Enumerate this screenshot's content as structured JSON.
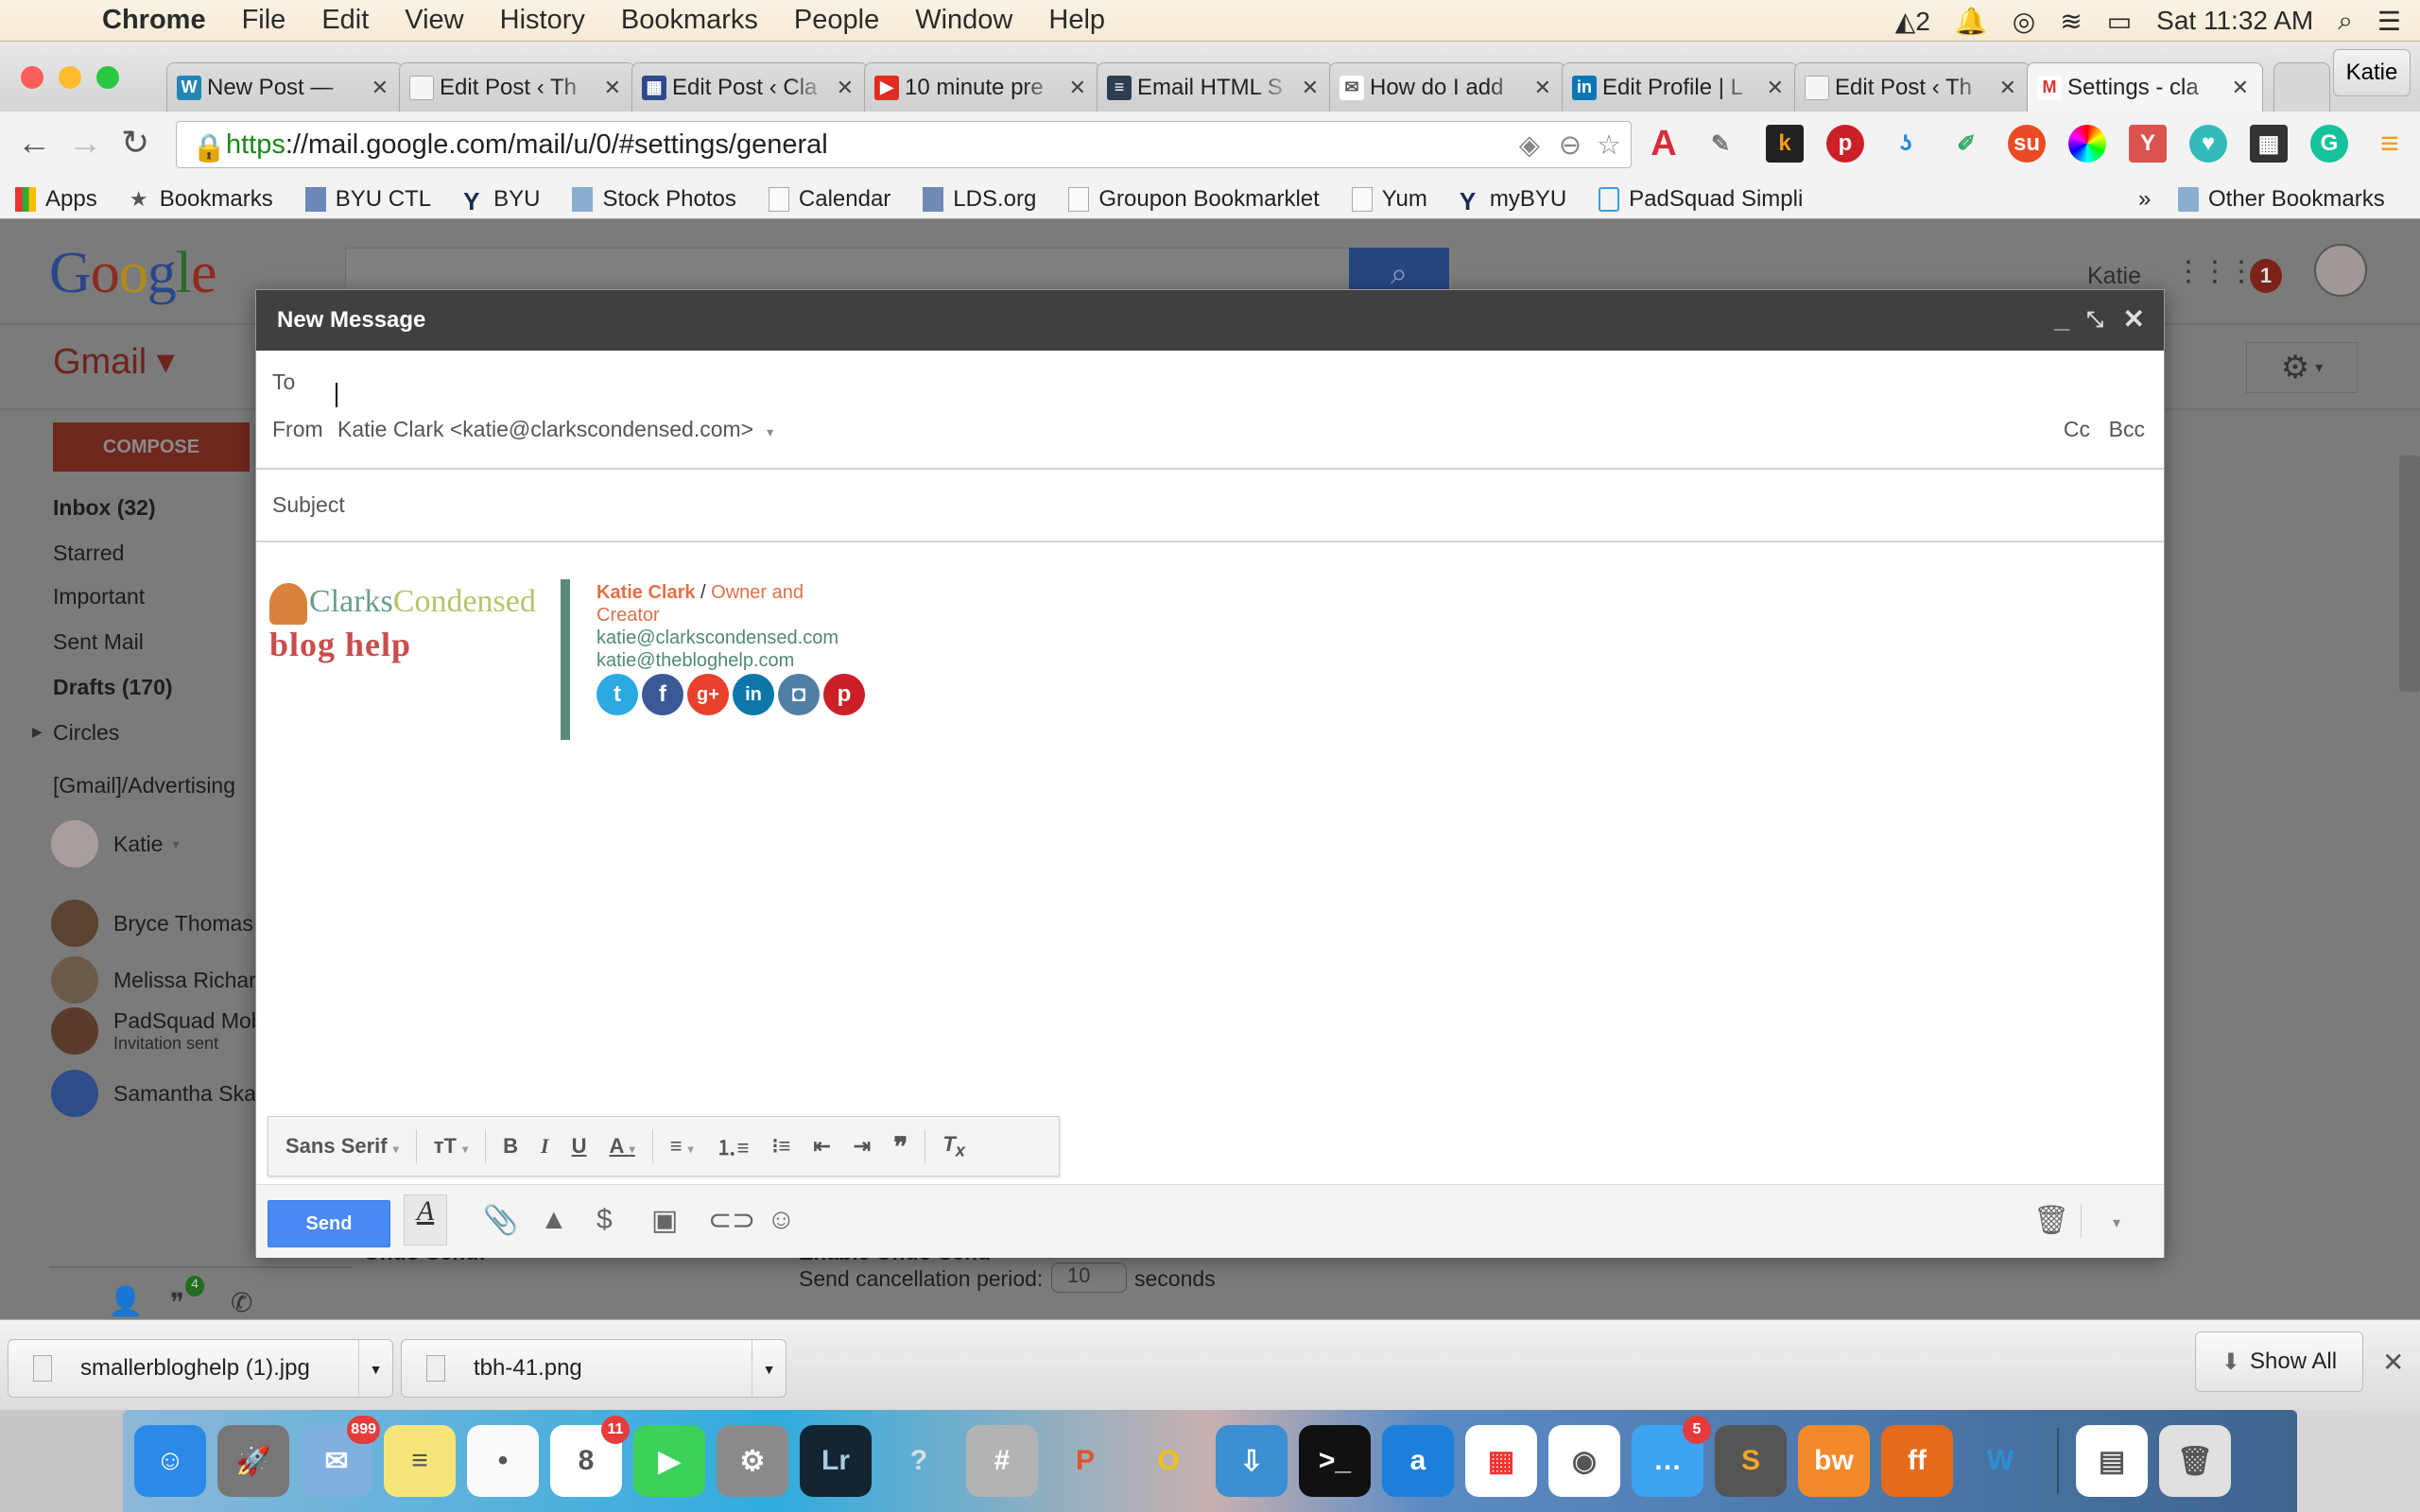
{
  "menubar": {
    "app": "Chrome",
    "items": [
      "File",
      "Edit",
      "View",
      "History",
      "Bookmarks",
      "People",
      "Window",
      "Help"
    ],
    "status": {
      "adobe_count": "2",
      "clock": "Sat 11:32 AM"
    }
  },
  "tabs": [
    {
      "title": "New Post — ",
      "icon": "wordpress-icon",
      "color": "#2385b5",
      "glyph": "W"
    },
    {
      "title": "Edit Post ‹ Th",
      "icon": "page-icon",
      "color": "#f5f5f5",
      "glyph": ""
    },
    {
      "title": "Edit Post ‹ Cla",
      "icon": "grid-site-icon",
      "color": "#2e4a8a",
      "glyph": "▦"
    },
    {
      "title": "10 minute pre",
      "icon": "youtube-icon",
      "color": "#e02b20",
      "glyph": "▶"
    },
    {
      "title": "Email HTML S",
      "icon": "document-icon",
      "color": "#2d3d52",
      "glyph": "≡"
    },
    {
      "title": "How do I add",
      "icon": "htmlsig-icon",
      "color": "#ffffff",
      "glyph": "✉"
    },
    {
      "title": "Edit Profile | L",
      "icon": "linkedin-icon",
      "color": "#0a77b5",
      "glyph": "in"
    },
    {
      "title": "Edit Post ‹ Th",
      "icon": "page-icon",
      "color": "#f5f5f5",
      "glyph": ""
    },
    {
      "title": "Settings - cla",
      "icon": "gmail-icon",
      "color": "#ffffff",
      "glyph": "M",
      "active": true
    }
  ],
  "profile_button": "Katie",
  "address": {
    "scheme": "https",
    "rest": "://mail.google.com/mail/u/0/#settings/general"
  },
  "bookmarks": [
    {
      "label": "Apps",
      "icon": "apps-grid-icon"
    },
    {
      "label": "Bookmarks",
      "icon": "star-icon"
    },
    {
      "label": "BYU CTL",
      "icon": "byu-ctl-icon"
    },
    {
      "label": "BYU",
      "icon": "byu-y-icon"
    },
    {
      "label": "Stock Photos",
      "icon": "folder-icon"
    },
    {
      "label": "Calendar",
      "icon": "page-icon"
    },
    {
      "label": "LDS.org",
      "icon": "lds-icon"
    },
    {
      "label": "Groupon Bookmarklet",
      "icon": "page-icon"
    },
    {
      "label": "Yum",
      "icon": "page-icon"
    },
    {
      "label": "myBYU",
      "icon": "byu-y-icon"
    },
    {
      "label": "PadSquad Simpli",
      "icon": "padsquad-icon"
    }
  ],
  "bookmarks_overflow": "»",
  "other_bookmarks": "Other Bookmarks",
  "gmail": {
    "logo": "Google",
    "brand": "Gmail",
    "user": "Katie",
    "notifications": "1",
    "compose": "COMPOSE",
    "nav": [
      {
        "label": "Inbox (32)",
        "bold": true
      },
      {
        "label": "Starred"
      },
      {
        "label": "Important"
      },
      {
        "label": "Sent Mail"
      },
      {
        "label": "Drafts (170)",
        "bold": true
      },
      {
        "label": "Circles"
      },
      {
        "label": "[Gmail]/Advertising"
      }
    ],
    "me": "Katie",
    "contacts": [
      {
        "name": "Bryce Thomas",
        "color": "#5a4330"
      },
      {
        "name": "Melissa Richards",
        "color": "#6b5a4a"
      },
      {
        "name": "PadSquad Mobile",
        "sub": "Invitation sent",
        "color": "#5b3b2b"
      },
      {
        "name": "Samantha Skaggs",
        "color": "#2c4d8a"
      }
    ],
    "hangouts_badge": "4",
    "settings": {
      "undo_label": "Undo Send:",
      "undo_option": "Enable Undo Send",
      "period_label": "Send cancellation period:",
      "period_value": "10",
      "period_unit": "seconds"
    }
  },
  "compose": {
    "title": "New Message",
    "to_label": "To",
    "to_value": "",
    "from_label": "From",
    "from_value": "Katie Clark <katie@clarkscondensed.com>",
    "cc": "Cc",
    "bcc": "Bcc",
    "subject_placeholder": "Subject",
    "signature": {
      "logo_line1_a": "Clarks",
      "logo_line1_b": "Condensed",
      "logo_line2": "blog help",
      "name": "Katie Clark",
      "sep": " / ",
      "role": "Owner and Creator",
      "email1": "katie@clarkscondensed.com",
      "email2": "katie@thebloghelp.com",
      "social": [
        {
          "name": "twitter",
          "glyph": "t",
          "color": "#2ba9e1"
        },
        {
          "name": "facebook",
          "glyph": "f",
          "color": "#3b5998"
        },
        {
          "name": "google-plus",
          "glyph": "g+",
          "color": "#e8412c"
        },
        {
          "name": "linkedin",
          "glyph": "in",
          "color": "#0e76a8"
        },
        {
          "name": "instagram",
          "glyph": "◘",
          "color": "#517fa4"
        },
        {
          "name": "pinterest",
          "glyph": "p",
          "color": "#cb2027"
        }
      ]
    },
    "font_family": "Sans Serif",
    "send": "Send"
  },
  "downloads": [
    {
      "file": "smallerbloghelp (1).jpg"
    },
    {
      "file": "tbh-41.png"
    }
  ],
  "show_all": "Show All",
  "dock": [
    {
      "name": "finder",
      "color": "#2b8ae8",
      "glyph": "☺"
    },
    {
      "name": "launchpad",
      "color": "#777",
      "glyph": "🚀"
    },
    {
      "name": "mail",
      "color": "#7fb0e0",
      "glyph": "✉",
      "badge": "899"
    },
    {
      "name": "notes",
      "color": "#f6e67a",
      "glyph": "≡"
    },
    {
      "name": "reminders",
      "color": "#fafafa",
      "glyph": "•"
    },
    {
      "name": "calendar",
      "color": "#ffffff",
      "glyph": "8",
      "badge": "11"
    },
    {
      "name": "facetime",
      "color": "#3ed15a",
      "glyph": "▶"
    },
    {
      "name": "system-preferences",
      "color": "#8a8a8a",
      "glyph": "⚙"
    },
    {
      "name": "lightroom",
      "color": "#132532",
      "glyph": "Lr"
    },
    {
      "name": "unknown-app",
      "color": "transparent",
      "glyph": "?"
    },
    {
      "name": "calculator",
      "color": "#b3b3b3",
      "glyph": "#"
    },
    {
      "name": "powerpoint",
      "color": "transparent",
      "glyph": "P"
    },
    {
      "name": "outlook",
      "color": "transparent",
      "glyph": "O"
    },
    {
      "name": "network-utility",
      "color": "#3c8fd3",
      "glyph": "⇩"
    },
    {
      "name": "terminal",
      "color": "#111",
      "glyph": ">_"
    },
    {
      "name": "amazon-cloud-drive",
      "color": "#1b7fdb",
      "glyph": "a"
    },
    {
      "name": "google-apps",
      "color": "#fff",
      "glyph": "▦"
    },
    {
      "name": "chrome",
      "color": "#fff",
      "glyph": "◉"
    },
    {
      "name": "messages",
      "color": "#3ca3f3",
      "glyph": "…",
      "badge": "5"
    },
    {
      "name": "sublime-text",
      "color": "#555",
      "glyph": "S"
    },
    {
      "name": "bookwright",
      "color": "#f28a2a",
      "glyph": "bw"
    },
    {
      "name": "firefox",
      "color": "#e66b1d",
      "glyph": "ff"
    },
    {
      "name": "word",
      "color": "transparent",
      "glyph": "W"
    },
    {
      "name": "bookwright-doc",
      "color": "#fff",
      "glyph": "▤"
    },
    {
      "name": "trash",
      "color": "#e0e0e0",
      "glyph": "🗑"
    }
  ]
}
